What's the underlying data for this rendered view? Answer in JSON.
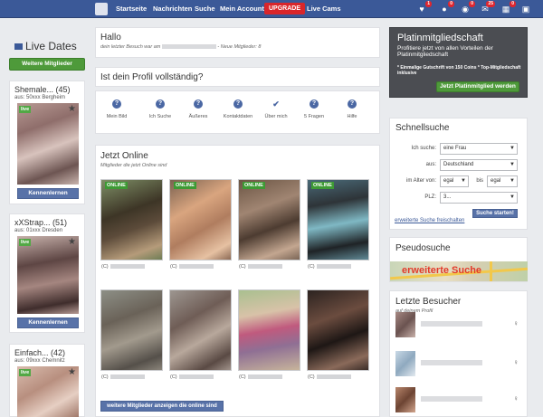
{
  "nav": {
    "items": [
      "Startseite",
      "Nachrichten",
      "Suche",
      "Mein Account"
    ],
    "upgrade": "UPGRADE",
    "live_cams": "Live Cams",
    "badges": [
      "1",
      "0",
      "0",
      "25",
      "0"
    ]
  },
  "left": {
    "title": "Live Dates",
    "more_button": "Weitere Mitglieder",
    "live_label": "live",
    "cards": [
      {
        "name": "Shemale... (45)",
        "location": "aus: 50xxx Bergheim",
        "button": "Kennenlernen"
      },
      {
        "name": "xXStrap... (51)",
        "location": "aus: 01xxx Dresden",
        "button": "Kennenlernen"
      },
      {
        "name": "Einfach... (42)",
        "location": "aus: 09xxx Chemnitz"
      }
    ]
  },
  "hallo": {
    "title": "Hallo",
    "sub_prefix": "dein letzter Besuch war am",
    "sub_suffix": "- Neue Mitglieder: 8"
  },
  "profile": {
    "title": "Ist dein Profil vollständig?",
    "items": [
      "Mein Bild",
      "Ich Suche",
      "Äußeres",
      "Kontaktdaten",
      "Über mich",
      "5 Fragen",
      "Hilfe"
    ]
  },
  "online": {
    "title": "Jetzt Online",
    "subtitle": "Mitglieder die jetzt Online sind",
    "badge": "ONLINE",
    "caption_prefix": "(C)",
    "more_button": "weitere Mitglieder anzeigen die online sind"
  },
  "premium": {
    "title": "Platinmitgliedschaft",
    "subtitle": "Profitiere jetzt von allen Vorteilen der Platinmitgliedschaft",
    "bullets": "* Einmalige Gutschrift von 150 Coins    * Top-Mitgliedschaft inklusive",
    "button": "Jetzt Platinmitglied werden"
  },
  "search": {
    "title": "Schnellsuche",
    "label_looking": "Ich suche:",
    "value_looking": "eine Frau",
    "label_from": "aus:",
    "value_from": "Deutschland",
    "label_age": "im Alter von:",
    "value_age_from": "egal",
    "label_to": "bis",
    "value_age_to": "egal",
    "label_zip": "PLZ:",
    "value_zip": "3...",
    "button": "Suche starten!",
    "link": "erweiterte Suche freischalten"
  },
  "pseudo": {
    "title": "Pseudosuche",
    "banner": "erweiterte Suche"
  },
  "visitors": {
    "title": "Letzte Besucher",
    "subtitle": "auf deinem Profil"
  }
}
